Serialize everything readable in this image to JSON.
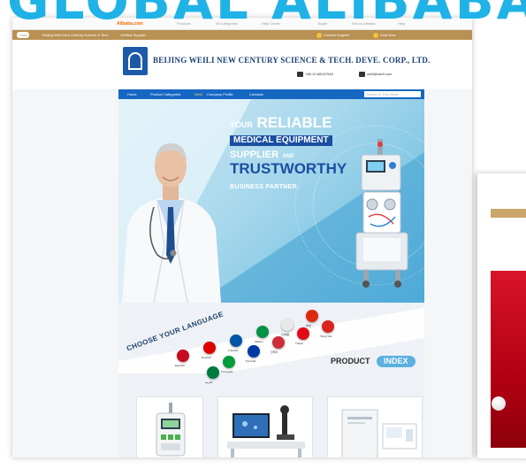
{
  "overlay": {
    "title": "GLOBAL ALIBABA"
  },
  "alibaba_bar": {
    "logo": "Alibaba.com",
    "links": [
      "Products",
      "All Categories",
      "Help Center",
      "Buyer",
      "Sell on Alibaba",
      "Help"
    ]
  },
  "store_bar": {
    "badge": "Gold",
    "company": "Beijing Weili New Century Science & Tech.",
    "verified": "Verified Supplier",
    "contact_supplier": "Contact Supplier",
    "chat": "Chat Now"
  },
  "company": {
    "name": "BEIJING WEILI NEW CENTURY SCIENCE & TECH. DEVE. CORP., LTD.",
    "phone": "+86-10-68167546",
    "email": "weili@weili.com"
  },
  "nav": {
    "items": [
      "Home",
      "Product Categories",
      "Weili",
      "Company Profile",
      "Contacts"
    ],
    "search_placeholder": "Search In This Store"
  },
  "hero": {
    "your": "YOUR",
    "reliable": "RELIABLE",
    "medical": "MEDICAL EQUIPMENT",
    "supplier": "SUPPLIER",
    "and": "AND",
    "trustworthy": "TRUSTWORTHY",
    "partner": "BUSINESS PARTNER."
  },
  "language": {
    "title": "CHOOSE YOUR LANGUAGE",
    "flags": [
      {
        "label": "Español",
        "color": "#c60b1e"
      },
      {
        "label": "Deutsch",
        "color": "#dd0000"
      },
      {
        "label": "Français",
        "color": "#0055a4"
      },
      {
        "label": "Italiano",
        "color": "#009246"
      },
      {
        "label": "日本語",
        "color": "#e8e8e8"
      },
      {
        "label": "中文",
        "color": "#de2910"
      },
      {
        "label": "Português",
        "color": "#009c3b"
      },
      {
        "label": "Русский",
        "color": "#0039a6"
      },
      {
        "label": "한국어",
        "color": "#cd2e3a"
      },
      {
        "label": "Türkçe",
        "color": "#e30a17"
      },
      {
        "label": "Tiếng Việt",
        "color": "#da251d"
      },
      {
        "label": "العربية",
        "color": "#007a3d"
      }
    ]
  },
  "product_index": {
    "product": "PRODUCT",
    "index": "INDEX"
  },
  "colors": {
    "nav": "#1567c2",
    "accent": "#1fb2e6",
    "store_bar": "#b89153"
  }
}
